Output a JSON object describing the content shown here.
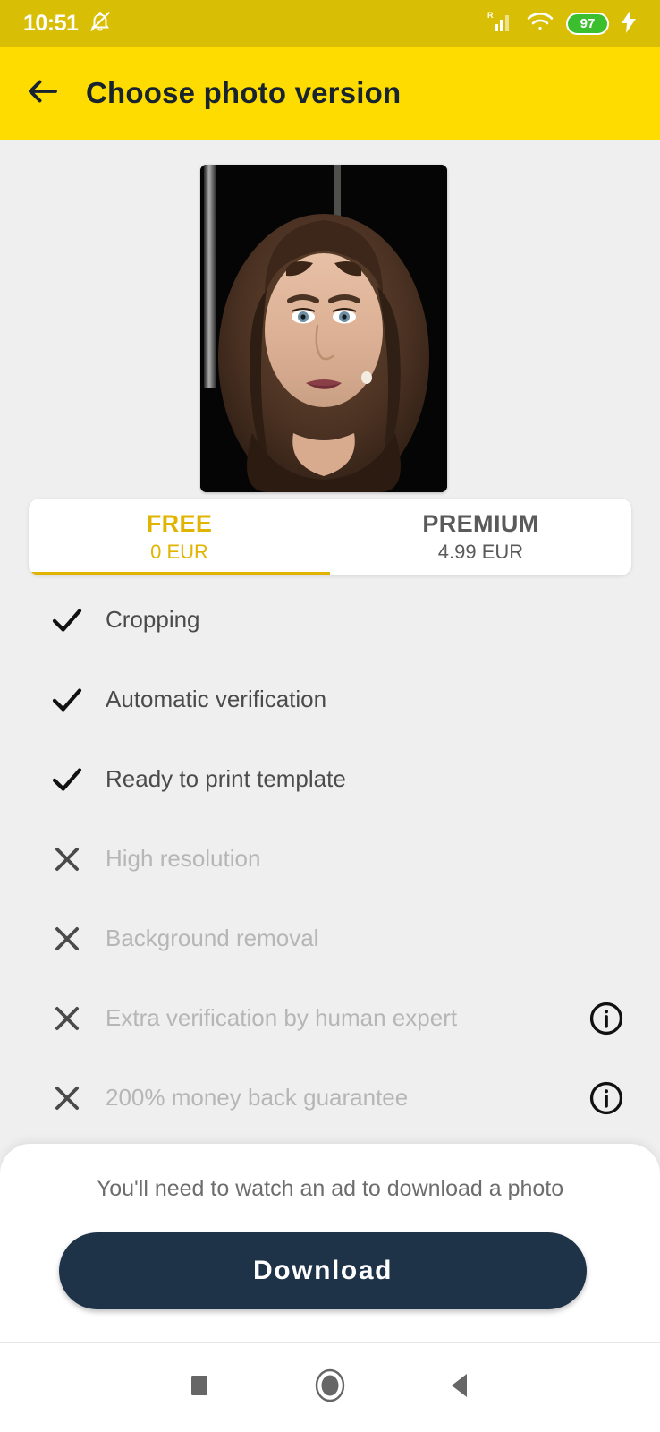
{
  "status_bar": {
    "time": "10:51",
    "icons": [
      "bell-muted-icon",
      "signal-roaming-icon",
      "wifi-icon",
      "battery-icon",
      "charging-bolt-icon"
    ],
    "battery_level": "97",
    "background_color": "#d9be06",
    "battery_fill_color": "#3bbf2f"
  },
  "app_bar": {
    "back_icon": "back-arrow-icon",
    "title": "Choose photo version",
    "background_color": "#ffdc00",
    "text_color": "#17232f"
  },
  "photo": {
    "alt": "cropped passport style portrait of a woman with long brown hair on a dark background"
  },
  "tabs": [
    {
      "title": "FREE",
      "price": "0 EUR",
      "selected": true,
      "accent_color": "#e0b400"
    },
    {
      "title": "PREMIUM",
      "price": "4.99 EUR",
      "selected": false,
      "color": "#5a5a5a"
    }
  ],
  "features": [
    {
      "label": "Cropping",
      "included": true,
      "mark": "check-icon",
      "info": false
    },
    {
      "label": "Automatic verification",
      "included": true,
      "mark": "check-icon",
      "info": false
    },
    {
      "label": "Ready to print template",
      "included": true,
      "mark": "check-icon",
      "info": false
    },
    {
      "label": "High resolution",
      "included": false,
      "mark": "cross-icon",
      "info": false
    },
    {
      "label": "Background removal",
      "included": false,
      "mark": "cross-icon",
      "info": false
    },
    {
      "label": "Extra verification by human expert",
      "included": false,
      "mark": "cross-icon",
      "info": true
    },
    {
      "label": "200% money back guarantee",
      "included": false,
      "mark": "cross-icon",
      "info": true
    }
  ],
  "bottom_sheet": {
    "note": "You'll need to watch an ad to download a photo",
    "download_label": "Download",
    "button_color": "#1e3248"
  },
  "nav_bar": {
    "recents": "square-recents-icon",
    "home": "circle-home-icon",
    "back": "triangle-back-icon"
  }
}
